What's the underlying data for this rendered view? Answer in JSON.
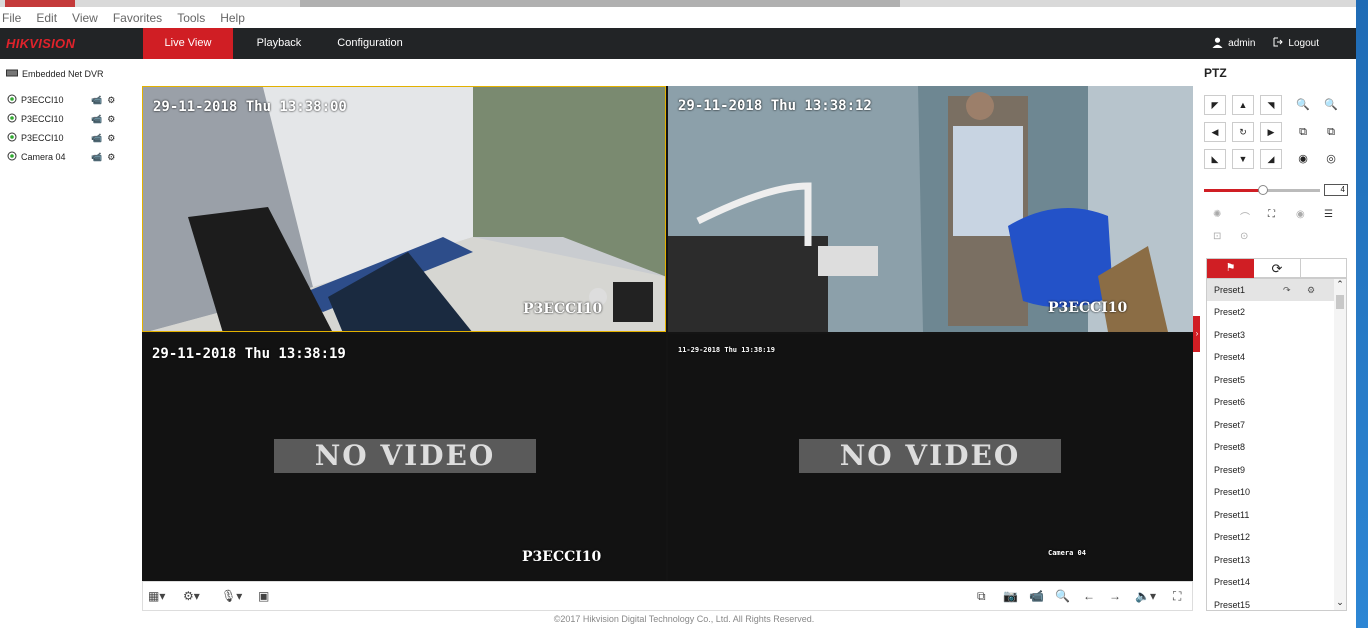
{
  "menu": [
    "File",
    "Edit",
    "View",
    "Favorites",
    "Tools",
    "Help"
  ],
  "brand": "HIKVISION",
  "nav": {
    "live_view": "Live View",
    "playback": "Playback",
    "configuration": "Configuration"
  },
  "user": {
    "name": "admin",
    "logout": "Logout"
  },
  "tree": {
    "root": "Embedded Net DVR",
    "cameras": [
      "P3ECCI10",
      "P3ECCI10",
      "P3ECCI10",
      "Camera 04"
    ]
  },
  "cells": [
    {
      "timestamp": "29-11-2018 Thu 13:38:00",
      "name": "P3ECCI10"
    },
    {
      "timestamp": "29-11-2018 Thu 13:38:12",
      "name": "P3ECCI10"
    },
    {
      "timestamp": "29-11-2018 Thu 13:38:19",
      "name": "P3ECCI10",
      "overlay": "NO VIDEO"
    },
    {
      "timestamp": "11-29-2018 Thu 13:38:19",
      "name": "Camera 04",
      "overlay": "NO VIDEO"
    }
  ],
  "ptz": {
    "title": "PTZ",
    "speed": "4",
    "presets": [
      "Preset1",
      "Preset2",
      "Preset3",
      "Preset4",
      "Preset5",
      "Preset6",
      "Preset7",
      "Preset8",
      "Preset9",
      "Preset10",
      "Preset11",
      "Preset12",
      "Preset13",
      "Preset14",
      "Preset15"
    ]
  },
  "footer": "©2017 Hikvision Digital Technology Co., Ltd. All Rights Reserved.",
  "colors": {
    "accent": "#d01e24",
    "topbar": "#222426",
    "video_bg": "#141414"
  }
}
